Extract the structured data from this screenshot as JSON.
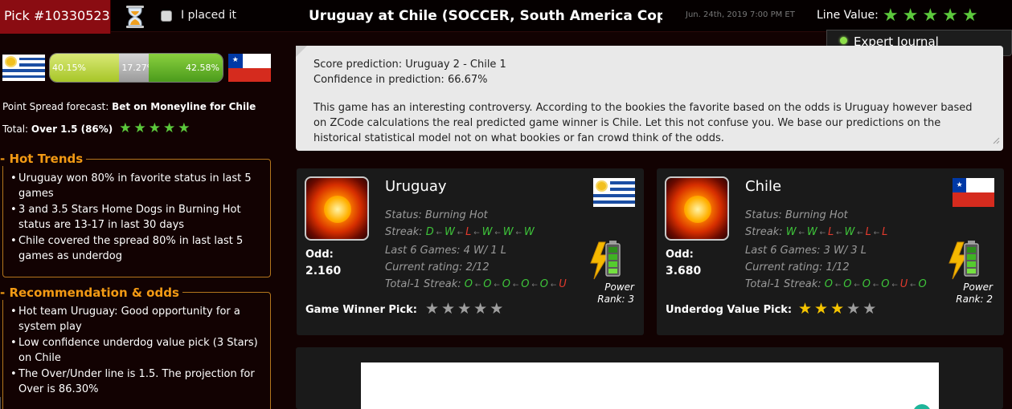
{
  "topbar": {
    "pick_label": "Pick #10330523",
    "placed_label": "I placed it",
    "title": "Uruguay at Chile (SOCCER, South America Copa ...",
    "datetime": "Jun. 24th, 2019 7:00 PM ET",
    "line_value_label": "Line Value:",
    "line_value_stars": 5,
    "expert_journal": "Expert Journal"
  },
  "probabilities": {
    "home_pct": "40.15%",
    "draw_pct": "17.27%",
    "away_pct": "42.58%",
    "home_value": 40.15,
    "draw_value": 17.27,
    "away_value": 42.58
  },
  "forecast": {
    "point_spread_label": "Point Spread forecast:",
    "point_spread_value": "Bet on Moneyline for Chile",
    "total_label": "Total:",
    "total_value": "Over 1.5 (86%)",
    "total_stars": 5
  },
  "hot_trends": {
    "title": "Hot Trends",
    "items": [
      "Uruguay won 80% in favorite status in last 5 games",
      "3 and 3.5 Stars Home Dogs in Burning Hot status are 13-17 in last 30 days",
      "Chile covered the spread 80% in last last 5 games as underdog"
    ]
  },
  "recommendation": {
    "title": "Recommendation & odds",
    "items": [
      "Hot team Uruguay: Good opportunity for a system play",
      "Low confidence underdog value pick (3 Stars) on Chile",
      "The Over/Under line is 1.5. The projection for Over is 86.30%"
    ]
  },
  "prediction": {
    "score": "Score prediction: Uruguay 2 - Chile 1",
    "confidence": "Confidence in prediction: 66.67%",
    "body": "This game has an interesting controversy. According to the bookies the favorite based on the odds is Uruguay however based on ZCode calculations the real predicted game winner is Chile. Let this not confuse you. We base our predictions on the historical statistical model not on what bookies or fan crowd think of the odds."
  },
  "teams": [
    {
      "name": "Uruguay",
      "status": "Status: Burning Hot",
      "streak_label": "Streak:",
      "streak": [
        "D",
        "W",
        "L",
        "W",
        "W",
        "W"
      ],
      "last6": "Last 6 Games: 4 W/ 1 L",
      "rating": "Current rating: 2/12",
      "total_streak_label": "Total-1 Streak:",
      "total_streak": [
        "O",
        "O",
        "O",
        "O",
        "O",
        "U"
      ],
      "odd_label": "Odd:",
      "odd": "2.160",
      "power_label": "Power",
      "rank_label": "Rank: 3",
      "pick_label": "Game Winner Pick:",
      "pick_stars": 0,
      "pick_star_color": "#9e9e9e"
    },
    {
      "name": "Chile",
      "status": "Status: Burning Hot",
      "streak_label": "Streak:",
      "streak": [
        "W",
        "W",
        "L",
        "W",
        "L",
        "L"
      ],
      "last6": "Last 6 Games: 3 W/ 3 L",
      "rating": "Current rating: 1/12",
      "total_streak_label": "Total-1 Streak:",
      "total_streak": [
        "O",
        "O",
        "O",
        "O",
        "U",
        "O"
      ],
      "odd_label": "Odd:",
      "odd": "3.680",
      "power_label": "Power",
      "rank_label": "Rank: 2",
      "pick_label": "Underdog Value Pick:",
      "pick_stars": 3,
      "pick_star_color": "#f5c400"
    }
  ],
  "colors": {
    "accent_orange": "#f29a14",
    "pick_red": "#8a0c12",
    "star_green": "#5cc93c",
    "win_green": "#3ec43a",
    "loss_red": "#e23a2d"
  }
}
